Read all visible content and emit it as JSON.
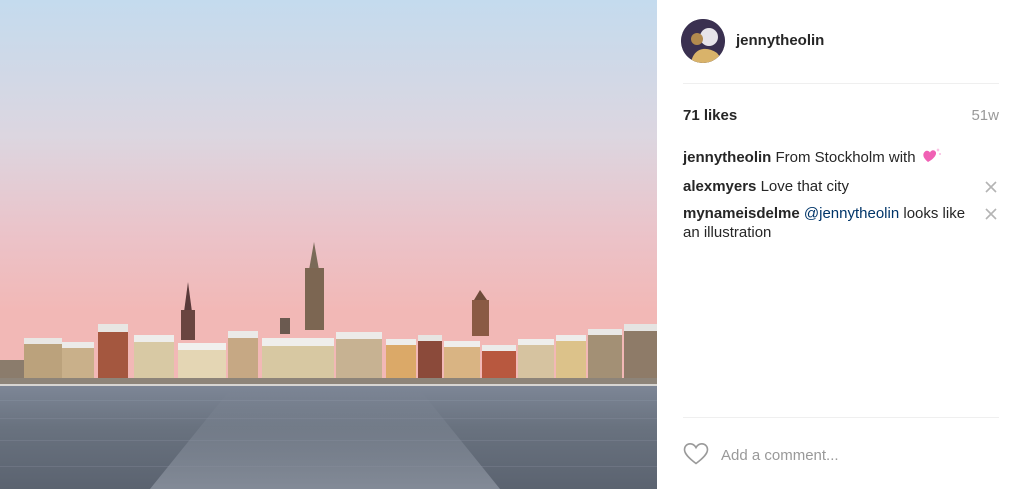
{
  "photo": {
    "subject": "Stockholm skyline at dusk across the water",
    "sky_top_color": "#c6dbec",
    "sky_bottom_color": "#f0b9ba",
    "water_color": "#66707f"
  },
  "post": {
    "username": "jennytheolin",
    "likes": "71 likes",
    "time_ago": "51w"
  },
  "comments": [
    {
      "author": "jennytheolin",
      "text": "From Stockholm with",
      "emoji": "sparkling-heart-icon",
      "deletable": false
    },
    {
      "author": "alexmyers",
      "text": "Love that city",
      "deletable": true
    },
    {
      "author": "mynameisdelme",
      "mention": "@jennytheolin",
      "text": "looks like an illustration",
      "deletable": true
    }
  ],
  "comment_bar": {
    "placeholder": "Add a comment...",
    "like_icon": "heart-outline-icon"
  },
  "colors": {
    "text": "#262626",
    "muted": "#999999",
    "mention": "#003569",
    "divider": "#efefef"
  }
}
